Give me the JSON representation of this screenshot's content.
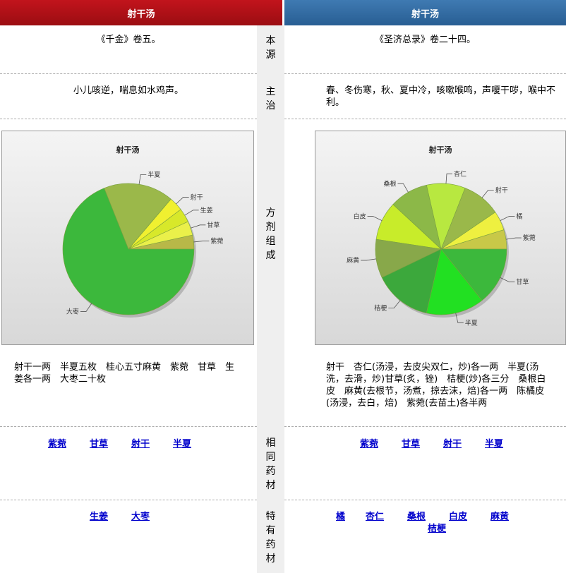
{
  "headers": {
    "left": "射干汤",
    "right": "射干汤"
  },
  "row_labels": {
    "source": "本\n源",
    "indication": "主\n治",
    "formula": "方\n剂\n组\n成",
    "common": "相\n同\n药\n材",
    "unique": "特\n有\n药\n材"
  },
  "left": {
    "source": "《千金》卷五。",
    "indication": "小儿咳逆，喘息如水鸡声。",
    "composition": "射干一两　半夏五枚　桂心五寸麻黄　紫菀　甘草　生姜各一两　大枣二十枚",
    "common_herbs": [
      "紫菀",
      "甘草",
      "射干",
      "半夏"
    ],
    "unique_herbs": [
      "生姜",
      "大枣"
    ]
  },
  "right": {
    "source": "《圣济总录》卷二十四。",
    "indication": "春、冬伤寒，秋、夏中冷，咳嗽喉鸣，声嗄干哕，喉中不利。",
    "composition": "射干　杏仁(汤浸，去皮尖双仁，炒)各一两　半夏(汤洗，去滑，炒)甘草(炙，锉)　桔梗(炒)各三分　桑根白皮　麻黄(去根节，汤煮，掠去沫，焙)各一两　陈橘皮(汤浸，去白，焙)　紫菀(去苗土)各半两",
    "common_herbs": [
      "紫菀",
      "甘草",
      "射干",
      "半夏"
    ],
    "unique_herbs": [
      "橘",
      "杏仁",
      "桑根",
      "白皮",
      "麻黄",
      "桔梗"
    ]
  },
  "chart_data": [
    {
      "type": "pie",
      "title": "射干汤",
      "categories": [
        "大枣",
        "半夏",
        "射干",
        "生姜",
        "甘草",
        "紫菀"
      ],
      "values": [
        20,
        5,
        1,
        1,
        1,
        1
      ],
      "colors": [
        "#3cb83c",
        "#9bb84a",
        "#f0f030",
        "#d8e82a",
        "#eaf04a",
        "#b8b848"
      ]
    },
    {
      "type": "pie",
      "title": "射干汤",
      "categories": [
        "甘草",
        "半夏",
        "桔梗",
        "麻黄",
        "白皮",
        "桑根",
        "杏仁",
        "射干",
        "橘",
        "紫菀"
      ],
      "values": [
        0.75,
        0.75,
        0.75,
        0.5,
        0.5,
        0.5,
        0.5,
        0.5,
        0.25,
        0.25
      ],
      "colors": [
        "#3cb83c",
        "#22e022",
        "#3ca83c",
        "#88a84a",
        "#c8ec2a",
        "#8cb848",
        "#b8e840",
        "#9ab84a",
        "#eef040",
        "#c8c848"
      ]
    }
  ]
}
